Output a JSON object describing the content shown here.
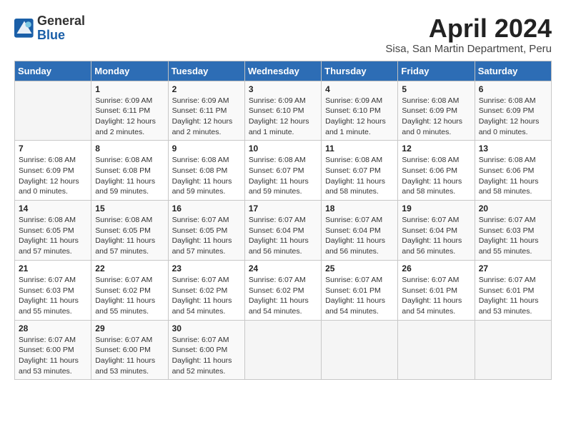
{
  "header": {
    "logo_line1": "General",
    "logo_line2": "Blue",
    "title": "April 2024",
    "subtitle": "Sisa, San Martin Department, Peru"
  },
  "weekdays": [
    "Sunday",
    "Monday",
    "Tuesday",
    "Wednesday",
    "Thursday",
    "Friday",
    "Saturday"
  ],
  "weeks": [
    [
      {
        "day": "",
        "info": ""
      },
      {
        "day": "1",
        "info": "Sunrise: 6:09 AM\nSunset: 6:11 PM\nDaylight: 12 hours\nand 2 minutes."
      },
      {
        "day": "2",
        "info": "Sunrise: 6:09 AM\nSunset: 6:11 PM\nDaylight: 12 hours\nand 2 minutes."
      },
      {
        "day": "3",
        "info": "Sunrise: 6:09 AM\nSunset: 6:10 PM\nDaylight: 12 hours\nand 1 minute."
      },
      {
        "day": "4",
        "info": "Sunrise: 6:09 AM\nSunset: 6:10 PM\nDaylight: 12 hours\nand 1 minute."
      },
      {
        "day": "5",
        "info": "Sunrise: 6:08 AM\nSunset: 6:09 PM\nDaylight: 12 hours\nand 0 minutes."
      },
      {
        "day": "6",
        "info": "Sunrise: 6:08 AM\nSunset: 6:09 PM\nDaylight: 12 hours\nand 0 minutes."
      }
    ],
    [
      {
        "day": "7",
        "info": "Sunrise: 6:08 AM\nSunset: 6:09 PM\nDaylight: 12 hours\nand 0 minutes."
      },
      {
        "day": "8",
        "info": "Sunrise: 6:08 AM\nSunset: 6:08 PM\nDaylight: 11 hours\nand 59 minutes."
      },
      {
        "day": "9",
        "info": "Sunrise: 6:08 AM\nSunset: 6:08 PM\nDaylight: 11 hours\nand 59 minutes."
      },
      {
        "day": "10",
        "info": "Sunrise: 6:08 AM\nSunset: 6:07 PM\nDaylight: 11 hours\nand 59 minutes."
      },
      {
        "day": "11",
        "info": "Sunrise: 6:08 AM\nSunset: 6:07 PM\nDaylight: 11 hours\nand 58 minutes."
      },
      {
        "day": "12",
        "info": "Sunrise: 6:08 AM\nSunset: 6:06 PM\nDaylight: 11 hours\nand 58 minutes."
      },
      {
        "day": "13",
        "info": "Sunrise: 6:08 AM\nSunset: 6:06 PM\nDaylight: 11 hours\nand 58 minutes."
      }
    ],
    [
      {
        "day": "14",
        "info": "Sunrise: 6:08 AM\nSunset: 6:05 PM\nDaylight: 11 hours\nand 57 minutes."
      },
      {
        "day": "15",
        "info": "Sunrise: 6:08 AM\nSunset: 6:05 PM\nDaylight: 11 hours\nand 57 minutes."
      },
      {
        "day": "16",
        "info": "Sunrise: 6:07 AM\nSunset: 6:05 PM\nDaylight: 11 hours\nand 57 minutes."
      },
      {
        "day": "17",
        "info": "Sunrise: 6:07 AM\nSunset: 6:04 PM\nDaylight: 11 hours\nand 56 minutes."
      },
      {
        "day": "18",
        "info": "Sunrise: 6:07 AM\nSunset: 6:04 PM\nDaylight: 11 hours\nand 56 minutes."
      },
      {
        "day": "19",
        "info": "Sunrise: 6:07 AM\nSunset: 6:04 PM\nDaylight: 11 hours\nand 56 minutes."
      },
      {
        "day": "20",
        "info": "Sunrise: 6:07 AM\nSunset: 6:03 PM\nDaylight: 11 hours\nand 55 minutes."
      }
    ],
    [
      {
        "day": "21",
        "info": "Sunrise: 6:07 AM\nSunset: 6:03 PM\nDaylight: 11 hours\nand 55 minutes."
      },
      {
        "day": "22",
        "info": "Sunrise: 6:07 AM\nSunset: 6:02 PM\nDaylight: 11 hours\nand 55 minutes."
      },
      {
        "day": "23",
        "info": "Sunrise: 6:07 AM\nSunset: 6:02 PM\nDaylight: 11 hours\nand 54 minutes."
      },
      {
        "day": "24",
        "info": "Sunrise: 6:07 AM\nSunset: 6:02 PM\nDaylight: 11 hours\nand 54 minutes."
      },
      {
        "day": "25",
        "info": "Sunrise: 6:07 AM\nSunset: 6:01 PM\nDaylight: 11 hours\nand 54 minutes."
      },
      {
        "day": "26",
        "info": "Sunrise: 6:07 AM\nSunset: 6:01 PM\nDaylight: 11 hours\nand 54 minutes."
      },
      {
        "day": "27",
        "info": "Sunrise: 6:07 AM\nSunset: 6:01 PM\nDaylight: 11 hours\nand 53 minutes."
      }
    ],
    [
      {
        "day": "28",
        "info": "Sunrise: 6:07 AM\nSunset: 6:00 PM\nDaylight: 11 hours\nand 53 minutes."
      },
      {
        "day": "29",
        "info": "Sunrise: 6:07 AM\nSunset: 6:00 PM\nDaylight: 11 hours\nand 53 minutes."
      },
      {
        "day": "30",
        "info": "Sunrise: 6:07 AM\nSunset: 6:00 PM\nDaylight: 11 hours\nand 52 minutes."
      },
      {
        "day": "",
        "info": ""
      },
      {
        "day": "",
        "info": ""
      },
      {
        "day": "",
        "info": ""
      },
      {
        "day": "",
        "info": ""
      }
    ]
  ]
}
